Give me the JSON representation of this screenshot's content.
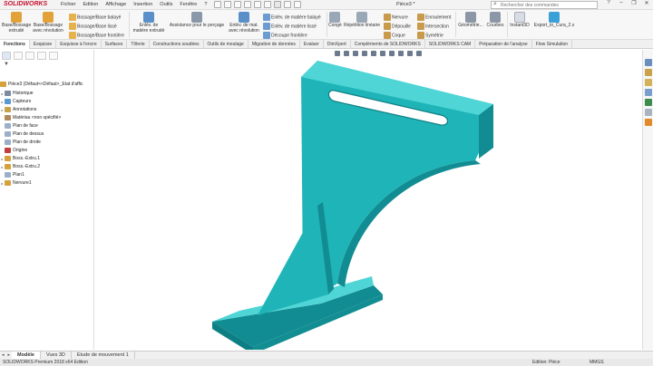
{
  "app": {
    "logo": "SOLIDWORKS",
    "document_title": "Pièce3 *",
    "search_placeholder": "Rechercher des commandes"
  },
  "menu": [
    "Fichier",
    "Edition",
    "Affichage",
    "Insertion",
    "Outils",
    "Fenêtre",
    "?"
  ],
  "window_controls": [
    "?",
    "–",
    "❐",
    "✕"
  ],
  "ribbon": {
    "extrude_boss": "Base/Bossage extrudé",
    "revolve_boss": "Base/Bossage avec révolution",
    "swept_boss": "Bossage/Base balayé",
    "lofted_boss": "Bossage/Base lissé",
    "boundary_boss": "Bossage/Base frontière",
    "extruded_cut": "Enlèv. de matière extrudé",
    "hole_wizard": "Assistance pour le perçage",
    "revolved_cut": "Enlèv. de mat. avec révolution",
    "swept_cut": "Enlèv. de matière balayé",
    "lofted_cut": "Enlèv. de matière lissé",
    "boundary_cut": "Découpe frontière",
    "fillet": "Congé",
    "linear_pattern": "Répétition linéaire",
    "rib": "Nervure",
    "draft": "Dépouille",
    "shell": "Coque",
    "wrap": "Enroulement",
    "intersect": "Intersection",
    "mirror": "Symétrie",
    "reference_geometry": "Géométrie...",
    "curves": "Courbes",
    "instant3d": "Instant3D",
    "export": "Export_to_Cura_2.x"
  },
  "tabs": [
    "Fonctions",
    "Esquisse",
    "Esquisse à l'encre",
    "Surfaces",
    "Tôlerie",
    "Constructions soudées",
    "Outils de moulage",
    "Migration de données",
    "Evaluer",
    "DimXpert",
    "Compléments de SOLIDWORKS",
    "SOLIDWORKS CAM",
    "Préparation de l'analyse",
    "Flow Simulation"
  ],
  "tree": {
    "root": "Pièce3  (Défaut<<Défaut>_Etat d'affic",
    "items": [
      {
        "label": "Historique",
        "icon": "history-icon"
      },
      {
        "label": "Capteurs",
        "icon": "sensor-icon"
      },
      {
        "label": "Annotations",
        "icon": "annotation-icon"
      },
      {
        "label": "Matériau <non spécifié>",
        "icon": "material-icon"
      },
      {
        "label": "Plan de face",
        "icon": "plane-icon"
      },
      {
        "label": "Plan de dessus",
        "icon": "plane-icon"
      },
      {
        "label": "Plan de droite",
        "icon": "plane-icon"
      },
      {
        "label": "Origine",
        "icon": "origin-icon"
      },
      {
        "label": "Boss.-Extru.1",
        "icon": "extrude-icon"
      },
      {
        "label": "Boss.-Extru.2",
        "icon": "extrude-icon"
      },
      {
        "label": "Plan1",
        "icon": "plane-icon"
      },
      {
        "label": "Nervure1",
        "icon": "rib-icon"
      }
    ]
  },
  "bottom_tabs": [
    "Modèle",
    "Vues 3D",
    "Etude de mouvement 1"
  ],
  "status": {
    "edition": "SOLIDWORKS Premium 2018 x64 Edition",
    "mode": "Edition: Pièce",
    "units": "MMGS"
  },
  "colors": {
    "model_face": "#1fb5b8",
    "model_top": "#4fd5d6",
    "model_dark": "#118c92",
    "accent": "#c8102e"
  }
}
